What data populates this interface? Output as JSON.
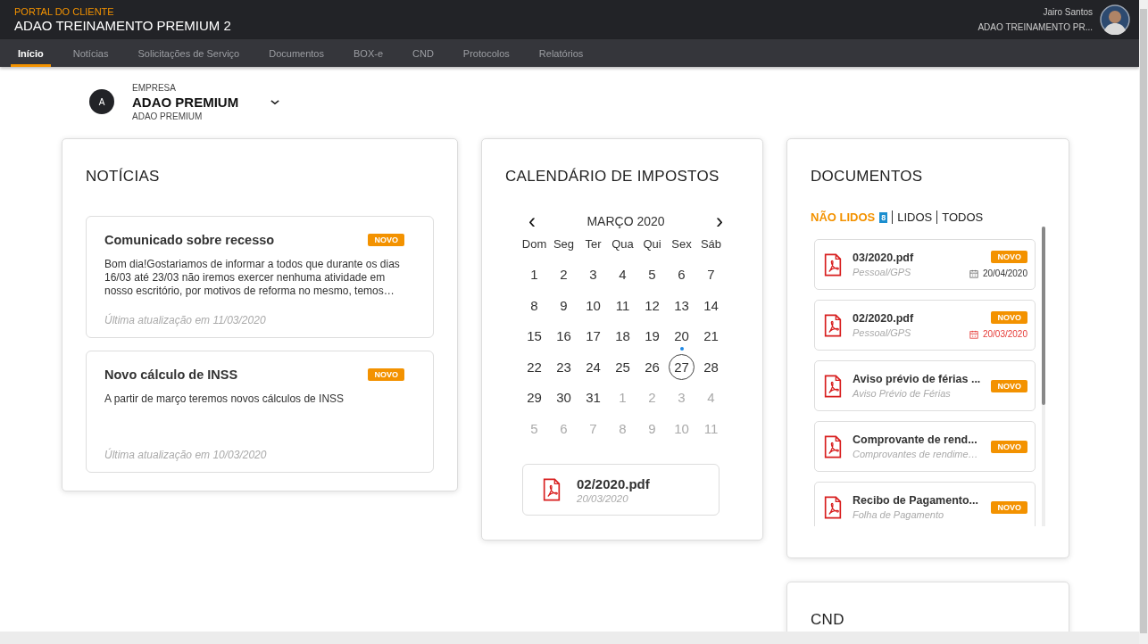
{
  "header": {
    "portal_label": "PORTAL DO CLIENTE",
    "title": "ADAO TREINAMENTO PREMIUM 2",
    "user_name": "Jairo Santos",
    "user_company": "ADAO TREINAMENTO PR..."
  },
  "nav": [
    {
      "label": "Início",
      "selected": true
    },
    {
      "label": "Notícias",
      "selected": false
    },
    {
      "label": "Solicitações de Serviço",
      "selected": false
    },
    {
      "label": "Documentos",
      "selected": false
    },
    {
      "label": "BOX-e",
      "selected": false
    },
    {
      "label": "CND",
      "selected": false
    },
    {
      "label": "Protocolos",
      "selected": false
    },
    {
      "label": "Relatórios",
      "selected": false
    }
  ],
  "company": {
    "initial": "A",
    "label": "EMPRESA",
    "name": "ADAO PREMIUM",
    "subtitle": "ADAO PREMIUM"
  },
  "news": {
    "title": "NOTÍCIAS",
    "items": [
      {
        "title": "Comunicado sobre recesso",
        "badge": "NOVO",
        "body": "Bom dia!Gostariamos de informar a todos que durante os dias 16/03 até 23/03  não iremos exercer nenhuma atividade em nosso escritório, por motivos de reforma no mesmo, temos…",
        "updated": "Última atualização em 11/03/2020"
      },
      {
        "title": "Novo cálculo de INSS",
        "badge": "NOVO",
        "body": "A partir de março teremos novos cálculos de INSS",
        "updated": "Última atualização em 10/03/2020"
      }
    ]
  },
  "calendar": {
    "title": "CALENDÁRIO DE IMPOSTOS",
    "prev": "‹",
    "next": "›",
    "month": "MARÇO 2020",
    "weekdays": [
      "Dom",
      "Seg",
      "Ter",
      "Qua",
      "Qui",
      "Sex",
      "Sáb"
    ],
    "weeks": [
      [
        {
          "day": "1",
          "outside": false,
          "event": false,
          "selected": false
        },
        {
          "day": "2",
          "outside": false,
          "event": false,
          "selected": false
        },
        {
          "day": "3",
          "outside": false,
          "event": false,
          "selected": false
        },
        {
          "day": "4",
          "outside": false,
          "event": false,
          "selected": false
        },
        {
          "day": "5",
          "outside": false,
          "event": false,
          "selected": false
        },
        {
          "day": "6",
          "outside": false,
          "event": false,
          "selected": false
        },
        {
          "day": "7",
          "outside": false,
          "event": false,
          "selected": false
        }
      ],
      [
        {
          "day": "8",
          "outside": false,
          "event": false,
          "selected": false
        },
        {
          "day": "9",
          "outside": false,
          "event": false,
          "selected": false
        },
        {
          "day": "10",
          "outside": false,
          "event": false,
          "selected": false
        },
        {
          "day": "11",
          "outside": false,
          "event": false,
          "selected": false
        },
        {
          "day": "12",
          "outside": false,
          "event": false,
          "selected": false
        },
        {
          "day": "13",
          "outside": false,
          "event": false,
          "selected": false
        },
        {
          "day": "14",
          "outside": false,
          "event": false,
          "selected": false
        }
      ],
      [
        {
          "day": "15",
          "outside": false,
          "event": false,
          "selected": false
        },
        {
          "day": "16",
          "outside": false,
          "event": false,
          "selected": false
        },
        {
          "day": "17",
          "outside": false,
          "event": false,
          "selected": false
        },
        {
          "day": "18",
          "outside": false,
          "event": false,
          "selected": false
        },
        {
          "day": "19",
          "outside": false,
          "event": false,
          "selected": false
        },
        {
          "day": "20",
          "outside": false,
          "event": true,
          "selected": false
        },
        {
          "day": "21",
          "outside": false,
          "event": false,
          "selected": false
        }
      ],
      [
        {
          "day": "22",
          "outside": false,
          "event": false,
          "selected": false
        },
        {
          "day": "23",
          "outside": false,
          "event": false,
          "selected": false
        },
        {
          "day": "24",
          "outside": false,
          "event": false,
          "selected": false
        },
        {
          "day": "25",
          "outside": false,
          "event": false,
          "selected": false
        },
        {
          "day": "26",
          "outside": false,
          "event": false,
          "selected": false
        },
        {
          "day": "27",
          "outside": false,
          "event": false,
          "selected": true
        },
        {
          "day": "28",
          "outside": false,
          "event": false,
          "selected": false
        }
      ],
      [
        {
          "day": "29",
          "outside": false,
          "event": false,
          "selected": false
        },
        {
          "day": "30",
          "outside": false,
          "event": false,
          "selected": false
        },
        {
          "day": "31",
          "outside": false,
          "event": false,
          "selected": false
        },
        {
          "day": "1",
          "outside": true,
          "event": false,
          "selected": false
        },
        {
          "day": "2",
          "outside": true,
          "event": false,
          "selected": false
        },
        {
          "day": "3",
          "outside": true,
          "event": false,
          "selected": false
        },
        {
          "day": "4",
          "outside": true,
          "event": false,
          "selected": false
        }
      ],
      [
        {
          "day": "5",
          "outside": true,
          "event": false,
          "selected": false
        },
        {
          "day": "6",
          "outside": true,
          "event": false,
          "selected": false
        },
        {
          "day": "7",
          "outside": true,
          "event": false,
          "selected": false
        },
        {
          "day": "8",
          "outside": true,
          "event": false,
          "selected": false
        },
        {
          "day": "9",
          "outside": true,
          "event": false,
          "selected": false
        },
        {
          "day": "10",
          "outside": true,
          "event": false,
          "selected": false
        },
        {
          "day": "11",
          "outside": true,
          "event": false,
          "selected": false
        }
      ]
    ],
    "event": {
      "file": "02/2020.pdf",
      "date": "20/03/2020"
    }
  },
  "documents": {
    "title": "DOCUMENTOS",
    "filters": [
      {
        "label": "NÃO LIDOS",
        "badge": "8",
        "selected": true
      },
      {
        "label": "LIDOS",
        "selected": false
      },
      {
        "label": "TODOS",
        "selected": false
      }
    ],
    "items": [
      {
        "title": "03/2020.pdf",
        "category": "Pessoal/GPS",
        "badge": "NOVO",
        "date": "20/04/2020",
        "overdue": false
      },
      {
        "title": "02/2020.pdf",
        "category": "Pessoal/GPS",
        "badge": "NOVO",
        "date": "20/03/2020",
        "overdue": true
      },
      {
        "title": "Aviso prévio de férias ...",
        "category": "Aviso Prévio de Férias",
        "badge": "NOVO"
      },
      {
        "title": "Comprovante de rend...",
        "category": "Comprovantes de rendime…",
        "badge": "NOVO"
      },
      {
        "title": "Recibo de Pagamento...",
        "category": "Folha de Pagamento",
        "badge": "NOVO"
      }
    ]
  },
  "cnd": {
    "title": "CND"
  }
}
